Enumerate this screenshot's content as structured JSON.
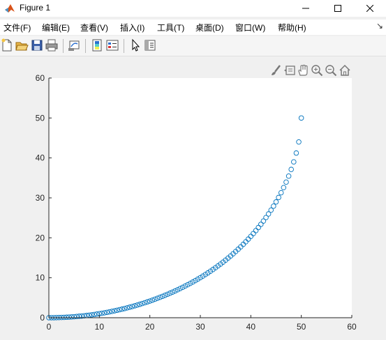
{
  "window": {
    "title": "Figure 1"
  },
  "menu": [
    {
      "label": "文件(F)"
    },
    {
      "label": "编辑(E)"
    },
    {
      "label": "查看(V)"
    },
    {
      "label": "插入(I)"
    },
    {
      "label": "工具(T)"
    },
    {
      "label": "桌面(D)"
    },
    {
      "label": "窗口(W)"
    },
    {
      "label": "帮助(H)"
    }
  ],
  "toolbar": [
    "new-figure-icon",
    "open-file-icon",
    "save-icon",
    "print-icon",
    "link-plot-icon",
    "colorbar-icon",
    "legend-icon",
    "pointer-icon",
    "property-inspector-icon"
  ],
  "axes_toolbar": [
    "brush-icon",
    "data-tips-icon",
    "pan-icon",
    "zoom-in-icon",
    "zoom-out-icon",
    "home-icon"
  ],
  "colors": {
    "marker": "#0072bd",
    "axes_bg": "#ffffff",
    "figure_bg": "#f0f0f0"
  },
  "chart_data": {
    "type": "scatter",
    "marker": "circle-open",
    "xlim": [
      0,
      60
    ],
    "ylim": [
      0,
      60
    ],
    "xticks": [
      "0",
      "10",
      "20",
      "30",
      "40",
      "50",
      "60"
    ],
    "yticks": [
      "0",
      "10",
      "20",
      "30",
      "40",
      "50",
      "60"
    ],
    "grid": false,
    "series": [
      {
        "x": [
          0,
          0.5,
          1.0,
          1.5,
          2.0,
          2.5,
          3.0,
          3.5,
          4.0,
          4.5,
          5.0,
          5.5,
          6.0,
          6.5,
          7.0,
          7.5,
          8.0,
          8.5,
          9.0,
          9.5,
          10.0,
          10.5,
          11.0,
          11.5,
          12.0,
          12.5,
          13.0,
          13.5,
          14.0,
          14.5,
          15.0,
          15.5,
          16.0,
          16.5,
          17.0,
          17.5,
          18.0,
          18.5,
          19.0,
          19.5,
          20.0,
          20.5,
          21.0,
          21.5,
          22.0,
          22.5,
          23.0,
          23.5,
          24.0,
          24.5,
          25.0,
          25.5,
          26.0,
          26.5,
          27.0,
          27.5,
          28.0,
          28.5,
          29.0,
          29.5,
          30.0,
          30.5,
          31.0,
          31.5,
          32.0,
          32.5,
          33.0,
          33.5,
          34.0,
          34.5,
          35.0,
          35.5,
          36.0,
          36.5,
          37.0,
          37.5,
          38.0,
          38.5,
          39.0,
          39.5,
          40.0,
          40.5,
          41.0,
          41.5,
          42.0,
          42.5,
          43.0,
          43.5,
          44.0,
          44.5,
          45.0,
          45.5,
          46.0,
          46.5,
          47.0,
          47.5,
          48.0,
          48.5,
          49.0,
          49.5,
          50.0
        ],
        "y": [
          0,
          0.0,
          0.0,
          0.02,
          0.04,
          0.06,
          0.09,
          0.12,
          0.16,
          0.2,
          0.25,
          0.3,
          0.36,
          0.42,
          0.49,
          0.56,
          0.64,
          0.72,
          0.81,
          0.91,
          1.01,
          1.11,
          1.22,
          1.34,
          1.46,
          1.59,
          1.72,
          1.86,
          2.0,
          2.15,
          2.3,
          2.46,
          2.63,
          2.8,
          2.98,
          3.16,
          3.35,
          3.55,
          3.75,
          3.96,
          4.17,
          4.39,
          4.62,
          4.86,
          5.1,
          5.35,
          5.61,
          5.87,
          6.14,
          6.42,
          6.7,
          7.0,
          7.3,
          7.61,
          7.93,
          8.26,
          8.59,
          8.94,
          9.29,
          9.66,
          10.03,
          10.42,
          10.81,
          11.22,
          11.64,
          12.07,
          12.51,
          12.97,
          13.44,
          13.92,
          14.42,
          14.93,
          15.46,
          16.01,
          16.57,
          17.15,
          17.75,
          18.37,
          19.01,
          19.68,
          20.36,
          21.07,
          21.81,
          22.58,
          23.38,
          24.21,
          25.07,
          25.98,
          26.93,
          27.93,
          28.99,
          30.1,
          31.29,
          32.57,
          33.95,
          35.45,
          37.12,
          39.0,
          41.22,
          44.0,
          50.0
        ]
      }
    ]
  }
}
